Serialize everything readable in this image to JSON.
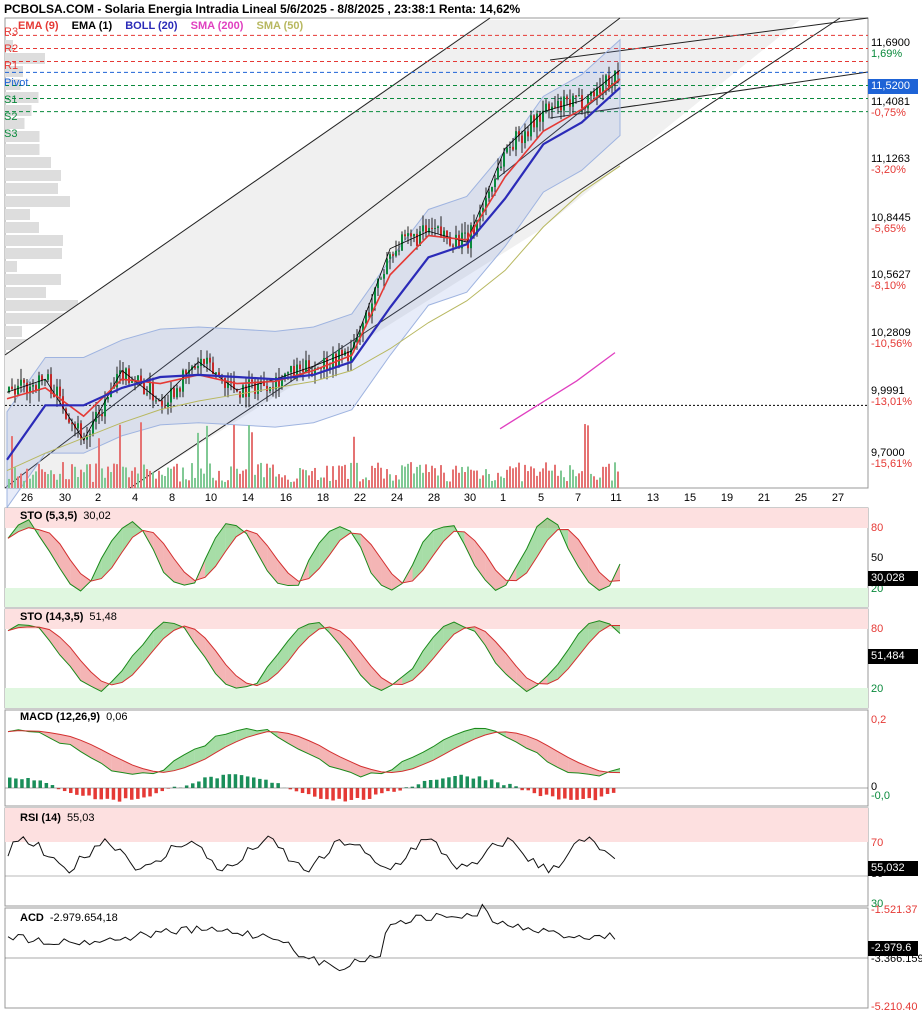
{
  "header": {
    "title": "PCBOLSA.COM - Solaria Energia Intradia Lineal 5/6/2025 - 8/8/2025 , 23:38:1 Renta: 14,62%"
  },
  "legend": [
    {
      "label": "EMA (9)",
      "color": "#e53935"
    },
    {
      "label": "EMA (1)",
      "color": "#000000"
    },
    {
      "label": "BOLL (20)",
      "color": "#2b2bb8"
    },
    {
      "label": "SMA (200)",
      "color": "#e040c0"
    },
    {
      "label": "SMA (50)",
      "color": "#b8b860"
    }
  ],
  "pivots": {
    "R3": "R3",
    "R2": "R2",
    "R1": "R1",
    "Pivot": "Pivot",
    "S1": "S1",
    "S2": "S2",
    "S3": "S3",
    "r_color": "#e53935",
    "pivot_color": "#1e63d6",
    "s_color": "#0a8a3c"
  },
  "price_axis": [
    {
      "price": "11,6900",
      "pct": "1,69%"
    },
    {
      "price": "11,4081",
      "pct": "-0,75%"
    },
    {
      "price": "11,1263",
      "pct": "-3,20%"
    },
    {
      "price": "10,8445",
      "pct": "-5,65%"
    },
    {
      "price": "10,5627",
      "pct": "-8,10%"
    },
    {
      "price": "10,2809",
      "pct": "-10,56%"
    },
    {
      "price": "9,9991",
      "pct": "-13,01%"
    },
    {
      "price": "9,7000",
      "pct": "-15,61%"
    }
  ],
  "last_price": "11,5200",
  "x_ticks": [
    "26",
    "30",
    "2",
    "4",
    "8",
    "10",
    "14",
    "16",
    "18",
    "22",
    "24",
    "28",
    "30",
    "1",
    "5",
    "7",
    "11",
    "13",
    "15",
    "19",
    "21",
    "25",
    "27"
  ],
  "panels": {
    "sto1": {
      "label": "STO (5,3,5)",
      "value": "30,02",
      "box": "30,028",
      "levels": [
        "80",
        "50",
        "20"
      ]
    },
    "sto2": {
      "label": "STO (14,3,5)",
      "value": "51,48",
      "box": "51,484",
      "levels": [
        "80",
        "20"
      ]
    },
    "macd": {
      "label": "MACD (12,26,9)",
      "value": "0,06",
      "levels": [
        "0,2",
        "0",
        "-0,0"
      ]
    },
    "rsi": {
      "label": "RSI (14)",
      "value": "55,03",
      "box": "55,032",
      "levels": [
        "70",
        "30",
        "30"
      ]
    },
    "acd": {
      "label": "ACD",
      "value": "-2.979.654,18",
      "box": "-2.979.6",
      "levels": [
        "-1.521.37",
        "-3.366.159",
        "-5.210.40"
      ]
    }
  },
  "chart_data": {
    "type": "line",
    "title": "PCBOLSA.COM - Solaria Energia Intradia Lineal 5/6/2025 - 8/8/2025 , 23:38:1 Renta: 14,62%",
    "x": [
      "26",
      "30",
      "2",
      "4",
      "8",
      "10",
      "14",
      "16",
      "18",
      "22",
      "24",
      "28",
      "30",
      "1",
      "5",
      "7",
      "11"
    ],
    "ylim": [
      9.62,
      11.78
    ],
    "series": [
      {
        "name": "EMA (1)",
        "values": [
          10.06,
          10.12,
          9.84,
          10.16,
          10.02,
          10.2,
          10.07,
          10.12,
          10.18,
          10.25,
          10.72,
          10.8,
          10.75,
          11.18,
          11.35,
          11.4,
          11.54
        ]
      },
      {
        "name": "EMA (9)",
        "values": [
          10.03,
          10.08,
          9.95,
          10.12,
          10.1,
          10.14,
          10.1,
          10.11,
          10.16,
          10.23,
          10.6,
          10.78,
          10.76,
          11.05,
          11.26,
          11.36,
          11.5
        ]
      },
      {
        "name": "BOLL (20)",
        "values": [
          9.75,
          10.0,
          10.0,
          10.08,
          10.13,
          10.14,
          10.13,
          10.12,
          10.14,
          10.2,
          10.45,
          10.68,
          10.74,
          10.95,
          11.2,
          11.3,
          11.46
        ]
      },
      {
        "name": "SMA (50)",
        "values": [
          9.7,
          9.78,
          9.85,
          9.92,
          9.98,
          10.02,
          10.05,
          10.08,
          10.11,
          10.16,
          10.26,
          10.38,
          10.48,
          10.62,
          10.82,
          10.98,
          11.1
        ]
      },
      {
        "name": "SMA (200)",
        "values": [
          null,
          null,
          null,
          null,
          null,
          null,
          null,
          null,
          null,
          null,
          null,
          null,
          null,
          10.03,
          10.14,
          10.25,
          10.38
        ]
      }
    ],
    "pivot_levels": {
      "R3": 11.7,
      "R2": 11.64,
      "R1": 11.58,
      "Pivot": 11.53,
      "S1": 11.47,
      "S2": 11.41,
      "S3": 11.35
    },
    "last_price": 11.52,
    "grid": false
  }
}
